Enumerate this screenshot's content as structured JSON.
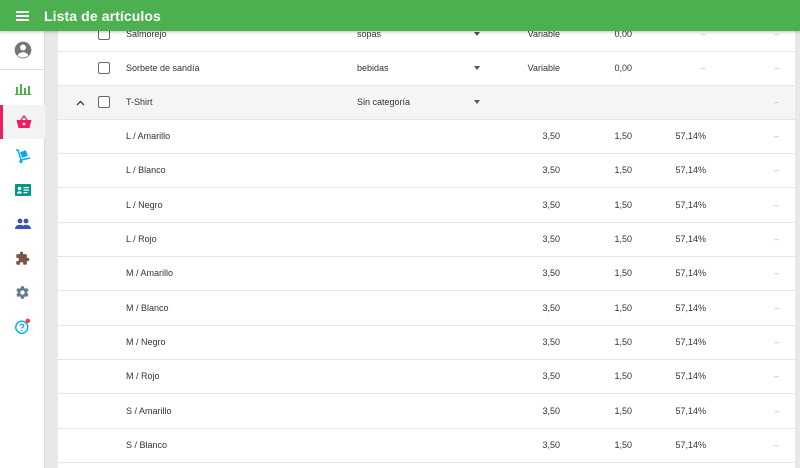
{
  "header": {
    "title": "Lista de artículos",
    "menu_icon": "menu-icon"
  },
  "sidebar": {
    "items": [
      {
        "name": "avatar",
        "icon": "account-circle-icon",
        "color": "#757575"
      },
      {
        "name": "reports",
        "icon": "bar-chart-icon",
        "color": "#4caf50"
      },
      {
        "name": "items",
        "icon": "basket-icon",
        "color": "#e91e63",
        "active": true
      },
      {
        "name": "inventory",
        "icon": "dolly-icon",
        "color": "#03a9f4"
      },
      {
        "name": "customers",
        "icon": "id-card-icon",
        "color": "#009688"
      },
      {
        "name": "employees",
        "icon": "people-icon",
        "color": "#3f51b5"
      },
      {
        "name": "apps",
        "icon": "puzzle-icon",
        "color": "#795548"
      },
      {
        "name": "settings",
        "icon": "gear-icon",
        "color": "#607d8b"
      },
      {
        "name": "help",
        "icon": "help-icon",
        "color": "#03a9f4"
      }
    ]
  },
  "rows": [
    {
      "type": "item",
      "name": "Salmorejo",
      "category": "sopas",
      "price": "Variable",
      "cost": "0,00",
      "margin": "",
      "dash1": "–",
      "dash2": "–"
    },
    {
      "type": "item",
      "name": "Sorbete de sandía",
      "category": "bebidas",
      "price": "Variable",
      "cost": "0,00",
      "margin": "",
      "dash1": "–",
      "dash2": "–"
    },
    {
      "type": "parent",
      "name": "T-Shirt",
      "category": "Sin categoría",
      "price": "",
      "cost": "",
      "margin": "",
      "dash1": "",
      "dash2": "–"
    },
    {
      "type": "variant",
      "name": "L / Amarillo",
      "price": "3,50",
      "cost": "1,50",
      "margin": "57,14%",
      "dash2": "–"
    },
    {
      "type": "variant",
      "name": "L / Blanco",
      "price": "3,50",
      "cost": "1,50",
      "margin": "57,14%",
      "dash2": "–"
    },
    {
      "type": "variant",
      "name": "L / Negro",
      "price": "3,50",
      "cost": "1,50",
      "margin": "57,14%",
      "dash2": "–"
    },
    {
      "type": "variant",
      "name": "L / Rojo",
      "price": "3,50",
      "cost": "1,50",
      "margin": "57,14%",
      "dash2": "–"
    },
    {
      "type": "variant",
      "name": "M / Amarillo",
      "price": "3,50",
      "cost": "1,50",
      "margin": "57,14%",
      "dash2": "–"
    },
    {
      "type": "variant",
      "name": "M / Blanco",
      "price": "3,50",
      "cost": "1,50",
      "margin": "57,14%",
      "dash2": "–"
    },
    {
      "type": "variant",
      "name": "M / Negro",
      "price": "3,50",
      "cost": "1,50",
      "margin": "57,14%",
      "dash2": "–"
    },
    {
      "type": "variant",
      "name": "M / Rojo",
      "price": "3,50",
      "cost": "1,50",
      "margin": "57,14%",
      "dash2": "–"
    },
    {
      "type": "variant",
      "name": "S / Amarillo",
      "price": "3,50",
      "cost": "1,50",
      "margin": "57,14%",
      "dash2": "–"
    },
    {
      "type": "variant",
      "name": "S / Blanco",
      "price": "3,50",
      "cost": "1,50",
      "margin": "57,14%",
      "dash2": "–"
    }
  ],
  "colors": {
    "topbar": "#4caf50",
    "active_indicator": "#e91e63"
  }
}
